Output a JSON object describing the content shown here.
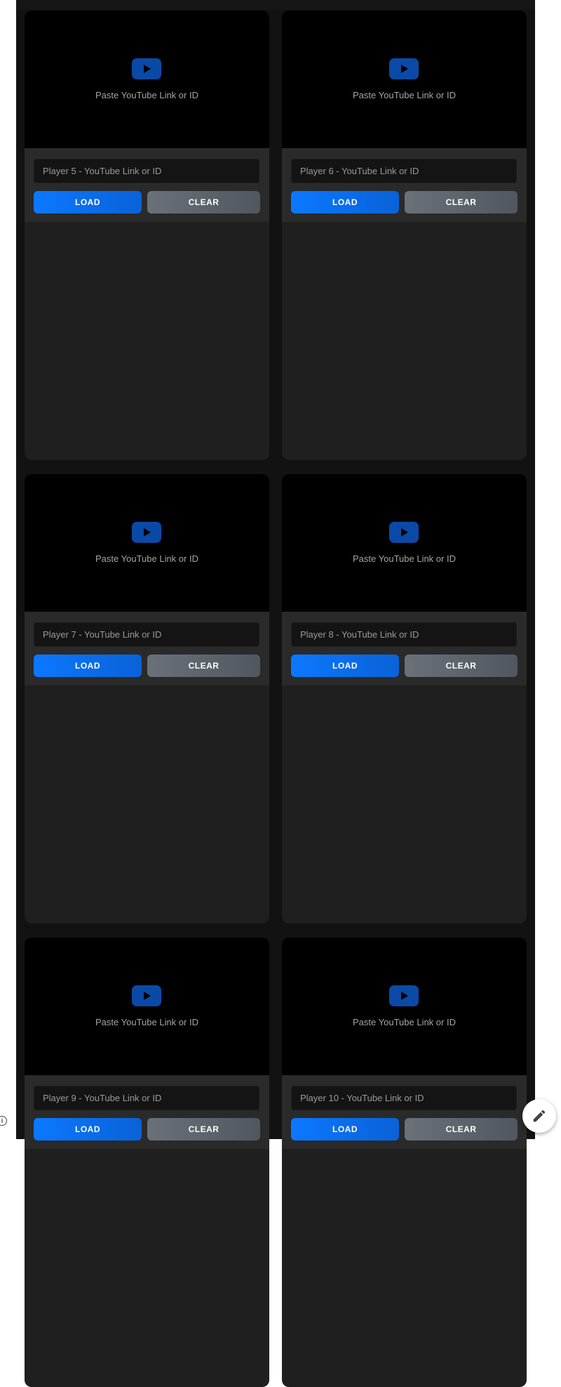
{
  "players": [
    {
      "hint": "Paste YouTube Link or ID",
      "placeholder": "Player 5 - YouTube Link or ID",
      "load_label": "LOAD",
      "clear_label": "CLEAR"
    },
    {
      "hint": "Paste YouTube Link or ID",
      "placeholder": "Player 6 - YouTube Link or ID",
      "load_label": "LOAD",
      "clear_label": "CLEAR"
    },
    {
      "hint": "Paste YouTube Link or ID",
      "placeholder": "Player 7 - YouTube Link or ID",
      "load_label": "LOAD",
      "clear_label": "CLEAR"
    },
    {
      "hint": "Paste YouTube Link or ID",
      "placeholder": "Player 8 - YouTube Link or ID",
      "load_label": "LOAD",
      "clear_label": "CLEAR"
    },
    {
      "hint": "Paste YouTube Link or ID",
      "placeholder": "Player 9 - YouTube Link or ID",
      "load_label": "LOAD",
      "clear_label": "CLEAR"
    },
    {
      "hint": "Paste YouTube Link or ID",
      "placeholder": "Player 10 - YouTube Link or ID",
      "load_label": "LOAD",
      "clear_label": "CLEAR"
    }
  ],
  "icons": {
    "video_placeholder": "youtube-play-icon",
    "info": "info-icon",
    "fab": "pencil-icon"
  },
  "colors": {
    "load_button": "#0b78ff",
    "clear_button": "#6a7179",
    "youtube_icon": "#0a4aa6",
    "card_background": "#1f1f1f",
    "page_background": "#121212"
  }
}
